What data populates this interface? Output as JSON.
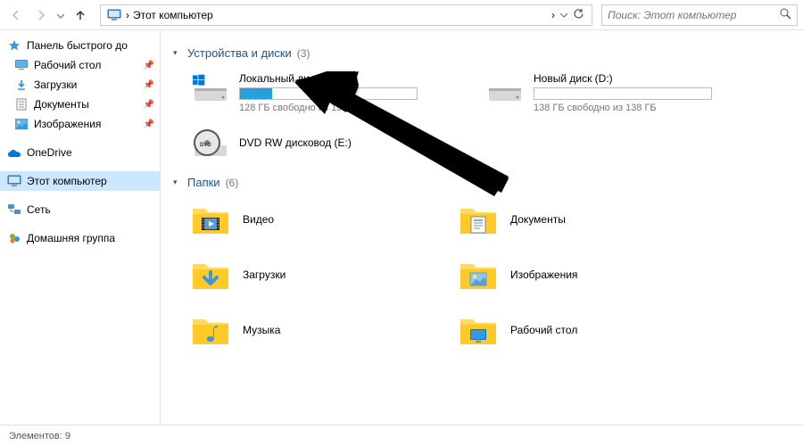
{
  "toolbar": {
    "address_location": "Этот компьютер",
    "search_placeholder": "Поиск: Этот компьютер"
  },
  "sidebar": {
    "quick_access": {
      "label": "Панель быстрого до",
      "items": [
        {
          "label": "Рабочий стол",
          "pinned": true
        },
        {
          "label": "Загрузки",
          "pinned": true
        },
        {
          "label": "Документы",
          "pinned": true
        },
        {
          "label": "Изображения",
          "pinned": true
        }
      ]
    },
    "onedrive": {
      "label": "OneDrive"
    },
    "this_pc": {
      "label": "Этот компьютер",
      "selected": true
    },
    "network": {
      "label": "Сеть"
    },
    "homegroup": {
      "label": "Домашняя группа"
    }
  },
  "main": {
    "groups": {
      "devices": {
        "title": "Устройства и диски",
        "count": "(3)"
      },
      "folders": {
        "title": "Папки",
        "count": "(6)"
      }
    },
    "drives": [
      {
        "name": "Локальный диск (C:)",
        "free_text": "128 ГБ свободно из 157 ГБ",
        "fill_percent": 18,
        "type": "windows"
      },
      {
        "name": "Новый диск (D:)",
        "free_text": "138 ГБ свободно из 138 ГБ",
        "fill_percent": 0,
        "type": "hdd"
      },
      {
        "name": "DVD RW дисковод (E:)",
        "free_text": "",
        "type": "dvd"
      }
    ],
    "folders": [
      {
        "label": "Видео"
      },
      {
        "label": "Документы"
      },
      {
        "label": "Загрузки"
      },
      {
        "label": "Изображения"
      },
      {
        "label": "Музыка"
      },
      {
        "label": "Рабочий стол"
      }
    ]
  },
  "status": {
    "text": "Элементов: 9"
  },
  "icons": {
    "separator": "›"
  }
}
